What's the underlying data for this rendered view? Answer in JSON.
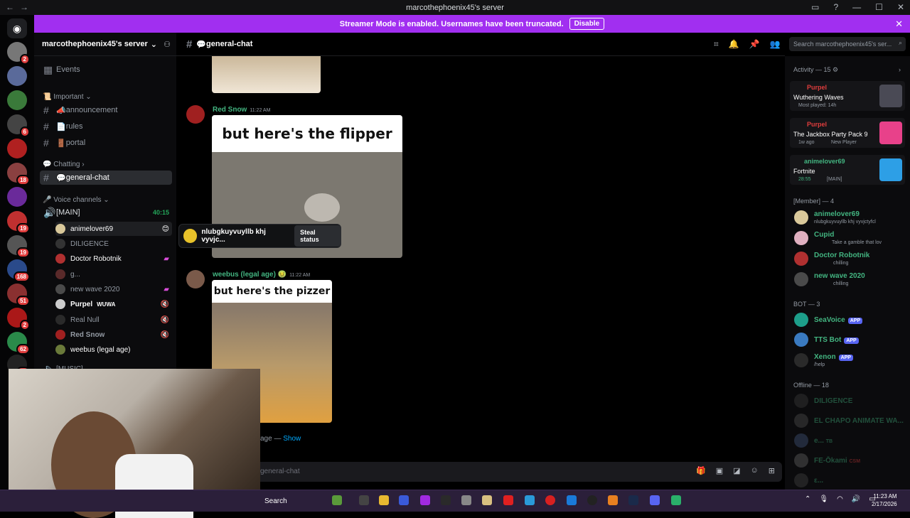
{
  "window": {
    "title": "marcothephoenix45's server",
    "icons": [
      "inbox-icon",
      "help-icon",
      "minimize-icon",
      "maximize-icon",
      "close-icon"
    ]
  },
  "banner": {
    "text": "Streamer Mode is enabled. Usernames have been truncated.",
    "button": "Disable"
  },
  "server": {
    "name": "marcothephoenix45's server",
    "events": "Events"
  },
  "categories": {
    "important": "Important",
    "chatting": "Chatting",
    "voice": "Voice channels",
    "music": "[MUSIC]"
  },
  "channels": {
    "announcement": "announcement",
    "rules": "rules",
    "portal": "portal",
    "general": "general-chat"
  },
  "voice": {
    "channel": "[MAIN]",
    "timer": "40:15",
    "users": [
      "animelover69",
      "DILIGENCE",
      "Doctor Robotnik",
      "g...",
      "new wave 2020",
      "Purpel",
      "Real Null",
      "Red Snow",
      "weebus (legal age)"
    ],
    "purpel_tag": "WUWA"
  },
  "popup": {
    "status": "nlubgkuyvuyllb khj vyvjc...",
    "button": "Steal status"
  },
  "chat": {
    "header": "general-chat",
    "msg1": {
      "author": "Red Snow",
      "time": "11:22 AM",
      "caption": "but here's the flipper"
    },
    "msg2": {
      "author": "weebus (legal age)",
      "time": "11:22 AM",
      "caption": "but here's the pizzer"
    },
    "hidden": "age —",
    "show": "Show",
    "input_placeholder": "general-chat"
  },
  "search": {
    "placeholder": "Search marcothephoenix45's ser..."
  },
  "activity": {
    "header": "Activity — 15",
    "items": [
      {
        "user": "Purpel",
        "game": "Wuthering Waves",
        "sub": "Most played: 14h"
      },
      {
        "user": "Purpel",
        "game": "The Jackbox Party Pack 9",
        "sub": "1w ago",
        "sub2": "New Player"
      },
      {
        "user": "animelover69",
        "game": "Fortnite",
        "sub": "28:55",
        "sub2": "[MAIN]"
      }
    ]
  },
  "members": {
    "header": "[Member] — 4",
    "list": [
      {
        "name": "animelover69",
        "sub": "nlubgkuyvuyllb khj vyvjctyfcl",
        "color": "#43b581"
      },
      {
        "name": "Cupid",
        "sub": "Take a gamble that lov",
        "color": "#43b581"
      },
      {
        "name": "Doctor Robotnik",
        "sub": "chilling",
        "color": "#43b581"
      },
      {
        "name": "new wave 2020",
        "sub": "chilling",
        "color": "#43b581"
      }
    ],
    "bot_header": "BOT — 3",
    "bots": [
      {
        "name": "SeaVoice",
        "badge": "APP"
      },
      {
        "name": "TTS Bot",
        "badge": "APP"
      },
      {
        "name": "Xenon",
        "badge": "APP",
        "sub": "/help"
      }
    ],
    "offline_header": "Offline — 18",
    "offline": [
      "DILIGENCE",
      "EL CHAPO ANIMATE WA...",
      "e...",
      "FE-Ōkami",
      "ε..."
    ],
    "offline_tags": [
      "",
      "",
      "TB",
      "CSM",
      ""
    ]
  },
  "taskbar": {
    "search": "Search",
    "time": "11:23 AM",
    "date": "2/17/2026"
  }
}
